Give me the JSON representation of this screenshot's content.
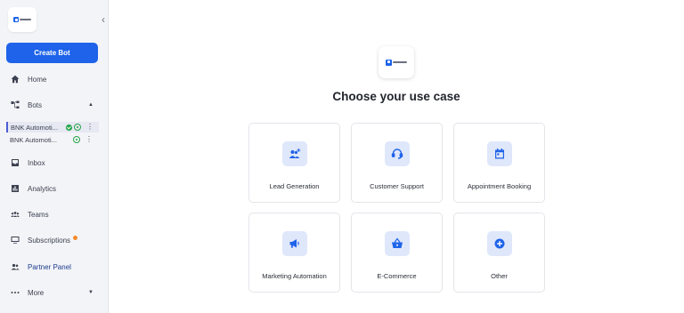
{
  "sidebar": {
    "create_bot": "Create Bot",
    "items": {
      "home": "Home",
      "bots": "Bots",
      "inbox": "Inbox",
      "analytics": "Analytics",
      "teams": "Teams",
      "subscriptions": "Subscriptions",
      "partner_panel": "Partner Panel",
      "more": "More"
    },
    "bots_list": [
      {
        "name": "BNK Automoti...",
        "status": "active"
      },
      {
        "name": "BNK Automoti..."
      }
    ]
  },
  "main": {
    "heading": "Choose your use case",
    "cards": [
      {
        "label": "Lead Generation",
        "icon": "add-user-icon"
      },
      {
        "label": "Customer Support",
        "icon": "headset-icon"
      },
      {
        "label": "Appointment Booking",
        "icon": "calendar-icon"
      },
      {
        "label": "Marketing Automation",
        "icon": "megaphone-icon"
      },
      {
        "label": "E-Commerce",
        "icon": "basket-icon"
      },
      {
        "label": "Other",
        "icon": "plus-circle-icon"
      }
    ]
  },
  "colors": {
    "primary": "#1e63e9",
    "icon_bg": "#dfe7fb",
    "success": "#22a447",
    "notification": "#f58a2a",
    "sidebar_bg": "#f3f4f7"
  }
}
